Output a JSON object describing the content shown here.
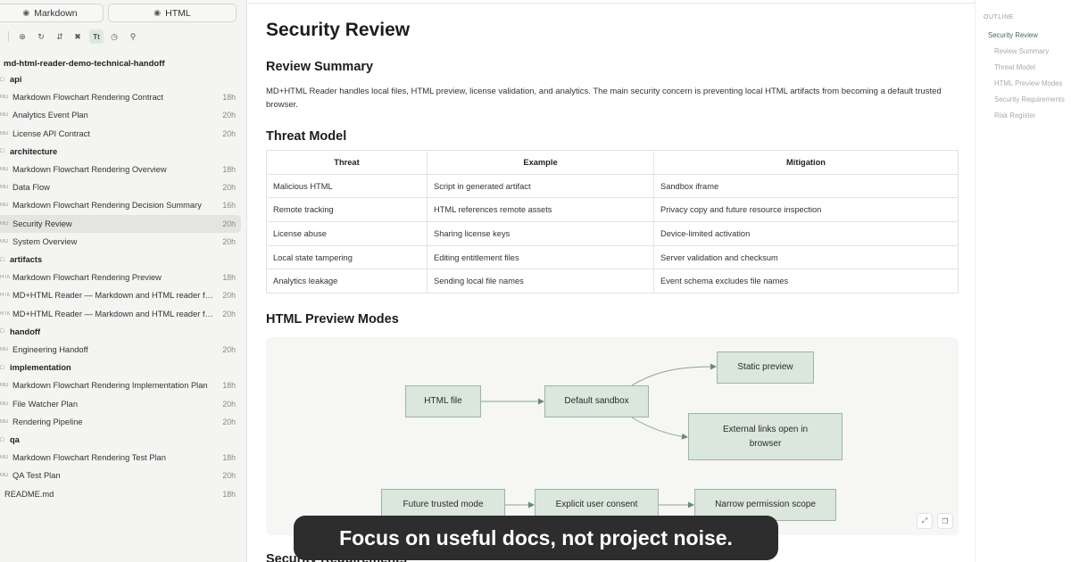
{
  "modes": {
    "markdown": "Markdown",
    "html": "HTML"
  },
  "toolbar_icons": [
    "target-icon",
    "refresh-icon",
    "expand-icon",
    "collapse-icon",
    "text-size-icon",
    "history-icon",
    "search-icon"
  ],
  "tree": {
    "root": "md-html-reader-demo-technical-handoff",
    "rows": [
      {
        "type": "folder",
        "label": "api"
      },
      {
        "type": "file",
        "badge": "MD",
        "label": "Markdown Flowchart Rendering Contract",
        "time": "18h"
      },
      {
        "type": "file",
        "badge": "MD",
        "label": "Analytics Event Plan",
        "time": "20h"
      },
      {
        "type": "file",
        "badge": "MD",
        "label": "License API Contract",
        "time": "20h"
      },
      {
        "type": "folder",
        "label": "architecture"
      },
      {
        "type": "file",
        "badge": "MD",
        "label": "Markdown Flowchart Rendering Overview",
        "time": "18h"
      },
      {
        "type": "file",
        "badge": "MD",
        "label": "Data Flow",
        "time": "20h"
      },
      {
        "type": "file",
        "badge": "MD",
        "label": "Markdown Flowchart Rendering Decision Summary",
        "time": "16h"
      },
      {
        "type": "file",
        "badge": "MD",
        "label": "Security Review",
        "time": "20h",
        "selected": true
      },
      {
        "type": "file",
        "badge": "MD",
        "label": "System Overview",
        "time": "20h"
      },
      {
        "type": "folder",
        "label": "artifacts"
      },
      {
        "type": "file",
        "badge": "HTML",
        "label": "Markdown Flowchart Rendering Preview",
        "time": "18h"
      },
      {
        "type": "file",
        "badge": "HTML",
        "label": "MD+HTML Reader — Markdown and HTML reader for A…",
        "time": "20h"
      },
      {
        "type": "file",
        "badge": "HTML",
        "label": "MD+HTML Reader — Markdown and HTML reader for A…",
        "time": "20h"
      },
      {
        "type": "folder",
        "label": "handoff"
      },
      {
        "type": "file",
        "badge": "MD",
        "label": "Engineering Handoff",
        "time": "20h"
      },
      {
        "type": "folder",
        "label": "implementation"
      },
      {
        "type": "file",
        "badge": "MD",
        "label": "Markdown Flowchart Rendering Implementation Plan",
        "time": "18h"
      },
      {
        "type": "file",
        "badge": "MD",
        "label": "File Watcher Plan",
        "time": "20h"
      },
      {
        "type": "file",
        "badge": "MD",
        "label": "Rendering Pipeline",
        "time": "20h"
      },
      {
        "type": "folder",
        "label": "qa"
      },
      {
        "type": "file",
        "badge": "MD",
        "label": "Markdown Flowchart Rendering Test Plan",
        "time": "18h"
      },
      {
        "type": "file",
        "badge": "MD",
        "label": "QA Test Plan",
        "time": "20h"
      },
      {
        "type": "root-file",
        "label": "README.md",
        "time": "18h"
      }
    ]
  },
  "doc": {
    "title": "Security Review",
    "review_summary": {
      "heading": "Review Summary",
      "text": "MD+HTML Reader handles local files, HTML preview, license validation, and analytics. The main security concern is preventing local HTML artifacts from becoming a default trusted browser."
    },
    "threat_model": {
      "heading": "Threat Model",
      "columns": [
        "Threat",
        "Example",
        "Mitigation"
      ],
      "rows": [
        [
          "Malicious HTML",
          "Script in generated artifact",
          "Sandbox iframe"
        ],
        [
          "Remote tracking",
          "HTML references remote assets",
          "Privacy copy and future resource inspection"
        ],
        [
          "License abuse",
          "Sharing license keys",
          "Device-limited activation"
        ],
        [
          "Local state tampering",
          "Editing entitlement files",
          "Server validation and checksum"
        ],
        [
          "Analytics leakage",
          "Sending local file names",
          "Event schema excludes file names"
        ]
      ]
    },
    "preview_modes": {
      "heading": "HTML Preview Modes",
      "nodes": {
        "html_file": "HTML file",
        "default_sandbox": "Default sandbox",
        "static_preview": "Static preview",
        "external_links": "External links open in browser",
        "future_trusted": "Future trusted mode",
        "explicit_consent": "Explicit user consent",
        "narrow_scope": "Narrow permission scope"
      }
    },
    "next_heading": "Security Requirements"
  },
  "outline": {
    "heading": "OUTLINE",
    "items": [
      "Security Review",
      "Review Summary",
      "Threat Model",
      "HTML Preview Modes",
      "Security Requirements",
      "Risk Register"
    ]
  },
  "caption": "Focus on useful docs, not project noise.",
  "colors": {
    "accent": "#3d6e57",
    "node_fill": "#dbe6dd",
    "node_border": "#9bb6a2",
    "caption_bg": "#2d2d2d"
  }
}
